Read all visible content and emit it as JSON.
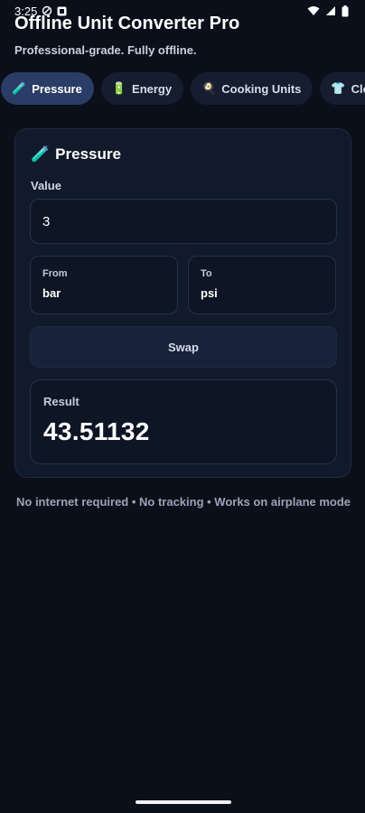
{
  "status_bar": {
    "time": "3:25",
    "icons": [
      "dnd-icon",
      "notification-icon",
      "wifi-icon",
      "signal-icon",
      "battery-icon"
    ]
  },
  "header": {
    "title": "Offline Unit Converter Pro",
    "subtitle": "Professional-grade. Fully offline."
  },
  "tabs": [
    {
      "emoji": "🧪",
      "label": "Pressure",
      "active": true
    },
    {
      "emoji": "🔋",
      "label": "Energy",
      "active": false
    },
    {
      "emoji": "🍳",
      "label": "Cooking Units",
      "active": false
    },
    {
      "emoji": "👕",
      "label": "Clothing",
      "active": false
    }
  ],
  "converter": {
    "emoji": "🧪",
    "title": "Pressure",
    "value_label": "Value",
    "value": "3",
    "from_label": "From",
    "from_value": "bar",
    "to_label": "To",
    "to_value": "psi",
    "swap_label": "Swap",
    "result_label": "Result",
    "result_value": "43.51132"
  },
  "footer": {
    "note": "No internet required • No tracking • Works on airplane mode"
  },
  "colors": {
    "background": "#0b0f1a",
    "card": "#111a2b",
    "active_tab": "#2a3d66",
    "tab": "#161d2e",
    "accent_text": "#ffffff",
    "muted_text": "#9aa3b6"
  }
}
